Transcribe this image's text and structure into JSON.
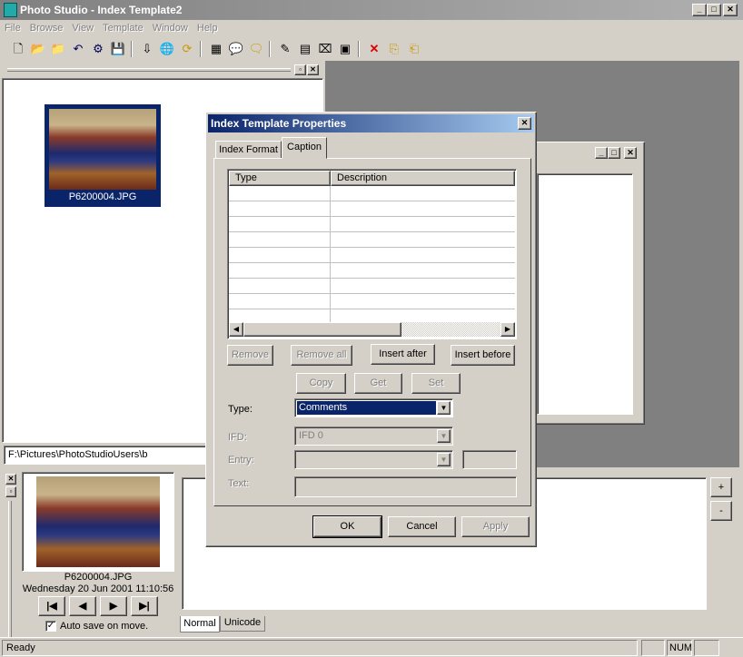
{
  "window": {
    "title": "Photo Studio - Index Template2"
  },
  "menu": [
    "File",
    "Browse",
    "View",
    "Template",
    "Window",
    "Help"
  ],
  "toolbar": {
    "icons": [
      "new-icon",
      "open-folder-icon",
      "open-image-icon",
      "undo-icon",
      "settings-icon",
      "save-icon",
      "download-icon",
      "globe-icon",
      "refresh-icon",
      "grid-icon",
      "caption-icon",
      "comments-icon",
      "pen-icon",
      "table-icon",
      "slideshow-icon",
      "monitor-icon",
      "delete-icon",
      "copy-icon",
      "paste-icon"
    ]
  },
  "thumbnail": {
    "filename": "P6200004.JPG"
  },
  "path_field": {
    "value": "F:\\Pictures\\PhotoStudioUsers\\b"
  },
  "preview": {
    "filename": "P6200004.JPG",
    "datetime": "Wednesday 20 Jun 2001 11:10:56",
    "autosave_label": "Auto save on move.",
    "autosave_checked": true
  },
  "nav": {
    "first": "|◀",
    "prev": "◀",
    "next": "▶",
    "last": "▶|"
  },
  "bottom_tabs": [
    "Normal",
    "Unicode"
  ],
  "side_buttons": {
    "plus": "+",
    "minus": "-"
  },
  "status": {
    "text": "Ready",
    "num": "NUM"
  },
  "dialog": {
    "title": "Index Template Properties",
    "tabs": [
      "Index Format",
      "Caption"
    ],
    "active_tab": "Caption",
    "table": {
      "columns": [
        "Type",
        "Description"
      ],
      "rows": 9
    },
    "buttons": {
      "remove": "Remove",
      "remove_all": "Remove all",
      "insert_after": "Insert after",
      "insert_before": "Insert before",
      "copy": "Copy",
      "get": "Get",
      "set": "Set",
      "ok": "OK",
      "cancel": "Cancel",
      "apply": "Apply"
    },
    "fields": {
      "type_label": "Type:",
      "type_value": "Comments",
      "ifd_label": "IFD:",
      "ifd_value": "IFD 0",
      "entry_label": "Entry:",
      "entry_value": "",
      "text_label": "Text:",
      "text_value": ""
    }
  }
}
